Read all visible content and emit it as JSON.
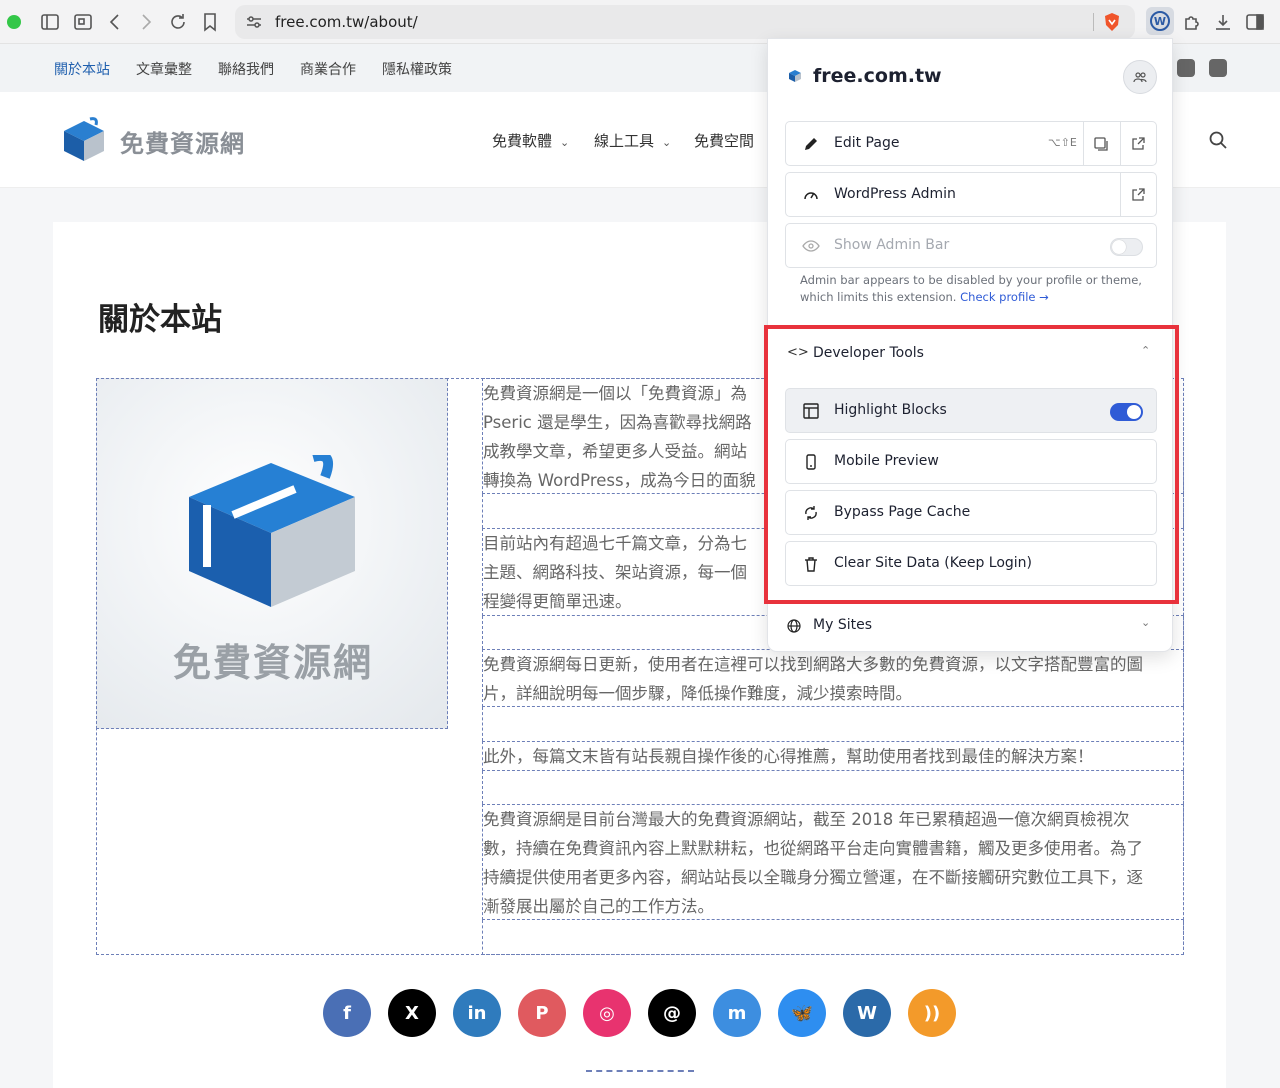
{
  "browser": {
    "url": "free.com.tw/about/"
  },
  "topnav": {
    "items": [
      "關於本站",
      "文章彙整",
      "聯絡我們",
      "商業合作",
      "隱私權政策"
    ]
  },
  "header": {
    "site_name": "免費資源網",
    "nav": [
      "免費軟體",
      "線上工具",
      "免費空間"
    ]
  },
  "content": {
    "title": "關於本站",
    "image_text": "免費資源網",
    "paragraphs": [
      [
        "免費資源網是一個以「免費資源」為",
        "Pseric 還是學生，因為喜歡尋找網路",
        "成教學文章，希望更多人受益。網站",
        "轉換為 WordPress，成為今日的面貌"
      ],
      [
        "目前站內有超過七千篇文章，分為七",
        "主題、網路科技、架站資源，每一個",
        "程變得更簡單迅速。"
      ],
      [
        "免費資源網每日更新，使用者在這裡可以找到網路大多數的免費資源，以文字搭配豐富的圖",
        "片，詳細說明每一個步驟，降低操作難度，減少摸索時間。"
      ],
      [
        "此外，每篇文末皆有站長親自操作後的心得推薦，幫助使用者找到最佳的解決方案！"
      ],
      [
        "免費資源網是目前台灣最大的免費資源網站，截至 2018 年已累積超過一億次網頁檢視次",
        "數，持續在免費資訊內容上默默耕耘，也從網路平台走向實體書籍，觸及更多使用者。為了",
        "持續提供使用者更多內容，網站站長以全職身分獨立營運，在不斷接觸研究數位工具下，逐",
        "漸發展出屬於自己的工作方法。"
      ]
    ]
  },
  "social": [
    {
      "name": "facebook",
      "glyph": "f",
      "color": "#4a6fb5"
    },
    {
      "name": "x",
      "glyph": "X",
      "color": "#000000"
    },
    {
      "name": "linkedin",
      "glyph": "in",
      "color": "#2f7bbd"
    },
    {
      "name": "pinterest",
      "glyph": "P",
      "color": "#e05a5f"
    },
    {
      "name": "instagram",
      "glyph": "◎",
      "color": "#e8336f"
    },
    {
      "name": "threads",
      "glyph": "@",
      "color": "#000000"
    },
    {
      "name": "mastodon",
      "glyph": "m",
      "color": "#3d8ee0"
    },
    {
      "name": "bluesky",
      "glyph": "🦋",
      "color": "#2e8ef0"
    },
    {
      "name": "wordpress",
      "glyph": "W",
      "color": "#2b6aa9"
    },
    {
      "name": "rss",
      "glyph": "))",
      "color": "#f39a2a"
    }
  ],
  "popup": {
    "domain": "free.com.tw",
    "edit_page": "Edit Page",
    "edit_shortcut": "⌥⇧E",
    "wp_admin": "WordPress Admin",
    "show_admin_bar": "Show Admin Bar",
    "note": "Admin bar appears to be disabled by your profile or theme, which limits this extension.",
    "note_link": "Check profile →",
    "dev_tools": "Developer Tools",
    "highlight_blocks": "Highlight Blocks",
    "mobile_preview": "Mobile Preview",
    "bypass_cache": "Bypass Page Cache",
    "clear_site_data": "Clear Site Data (Keep Login)",
    "my_sites": "My Sites"
  }
}
